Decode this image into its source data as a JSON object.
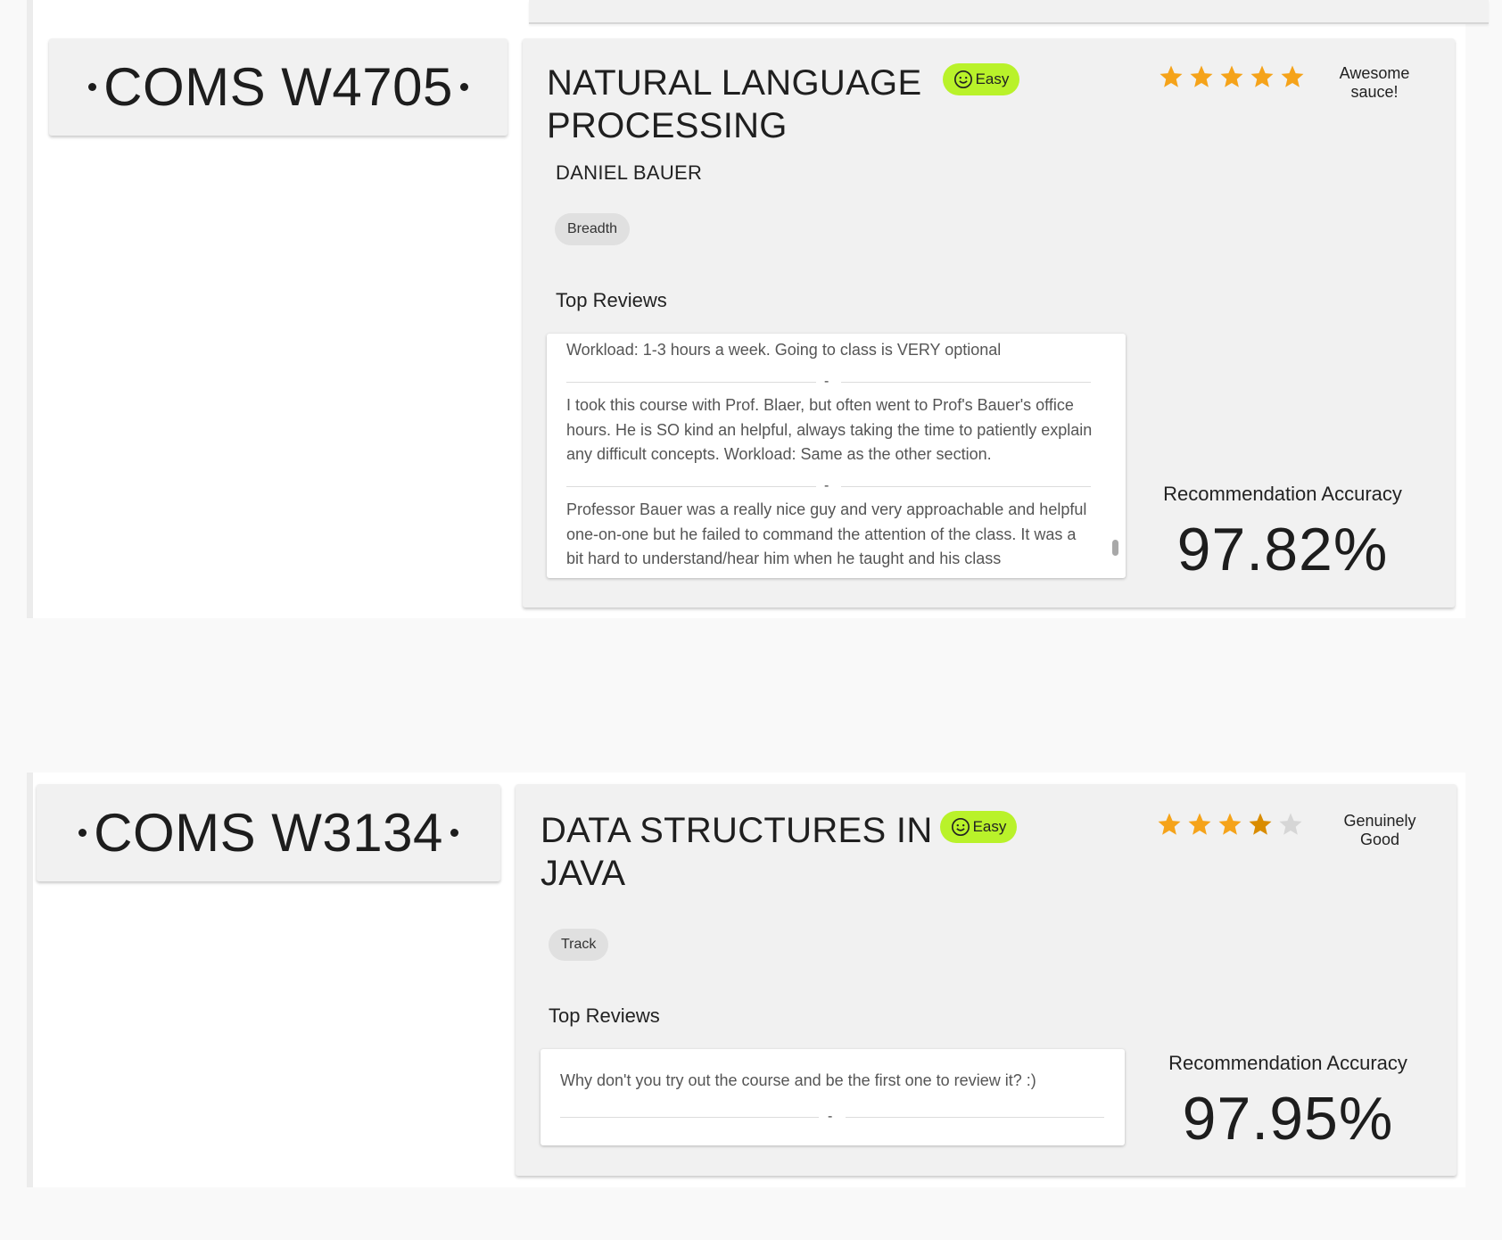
{
  "courses": [
    {
      "code": "COMS W4705",
      "title": "NATURAL LANGUAGE PROCESSING",
      "difficulty": "Easy",
      "rating": 5,
      "rating_label": "Awesome sauce!",
      "instructor": "DANIEL BAUER",
      "tag": "Breadth",
      "reviews_heading": "Top Reviews",
      "reviews": [
        "Workload: 1-3 hours a week. Going to class is VERY optional",
        "I took this course with Prof. Blaer, but often went to Prof's Bauer's office hours. He is SO kind an helpful, always taking the time to patiently explain any difficult concepts. Workload: Same as the other section.",
        "Professor Bauer was a really nice guy and very approachable and helpful one-on-one but he failed to command the attention of the class. It was a bit hard to understand/hear him when he taught and his class"
      ],
      "separator": "-",
      "accuracy_label": "Recommendation Accuracy",
      "accuracy_value": "97.82%"
    },
    {
      "code": "COMS W3134",
      "title": "DATA STRUCTURES IN JAVA",
      "difficulty": "Easy",
      "rating": 3.5,
      "rating_label": "Genuinely Good",
      "tag": "Track",
      "reviews_heading": "Top Reviews",
      "reviews": [
        "Why don't you try out the course and be the first one to review it? :)"
      ],
      "separator": "-",
      "accuracy_label": "Recommendation Accuracy",
      "accuracy_value": "97.95%"
    }
  ],
  "colors": {
    "star_full": "#f5a31a",
    "star_half": "#d98c00",
    "star_empty": "#d6d6d6",
    "badge": "#b9f22a",
    "card": "#f1f1f1"
  }
}
